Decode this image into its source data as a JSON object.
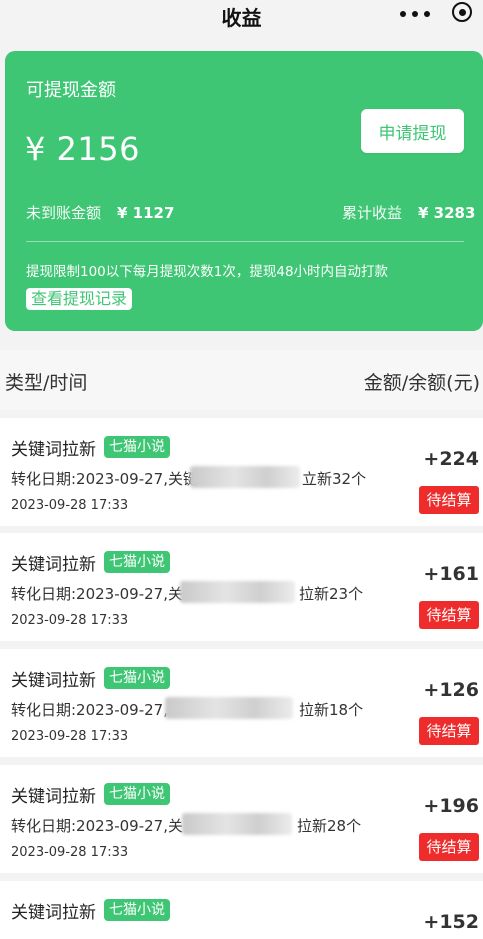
{
  "nav": {
    "title": "收益"
  },
  "card": {
    "title": "可提现金额",
    "amount": "¥ 2156",
    "withdraw_button": "申请提现",
    "pending_label": "未到账金额",
    "pending_value": "¥ 1127",
    "total_label": "累计收益",
    "total_value": "¥ 3283",
    "note": "提现限制100以下每月提现次数1次，提现48小时内自动打款",
    "record_button": "查看提现记录",
    "color": "#3fc674"
  },
  "list": {
    "header_left": "类型/时间",
    "header_right": "金额/余额(元)",
    "items": [
      {
        "title": "关键词拉新",
        "tag": "七猫小说",
        "desc": "转化日期:2023-09-27,关键",
        "desc_end": "立新32个",
        "time": "2023-09-28 17:33",
        "amount": "+224",
        "status": "待结算"
      },
      {
        "title": "关键词拉新",
        "tag": "七猫小说",
        "desc": "转化日期:2023-09-27,关",
        "desc_end": "拉新23个",
        "time": "2023-09-28 17:33",
        "amount": "+161",
        "status": "待结算"
      },
      {
        "title": "关键词拉新",
        "tag": "七猫小说",
        "desc": "转化日期:2023-09-27,",
        "desc_end": "拉新18个",
        "time": "2023-09-28 17:33",
        "amount": "+126",
        "status": "待结算"
      },
      {
        "title": "关键词拉新",
        "tag": "七猫小说",
        "desc": "转化日期:2023-09-27,关",
        "desc_end": "拉新28个",
        "time": "2023-09-28 17:33",
        "amount": "+196",
        "status": "待结算"
      },
      {
        "title": "关键词拉新",
        "tag": "七猫小说",
        "desc": "",
        "desc_end": "",
        "time": "",
        "amount": "+152",
        "status": ""
      }
    ]
  },
  "colors": {
    "accent": "#3fc674",
    "status_red": "#ef2c2c"
  }
}
